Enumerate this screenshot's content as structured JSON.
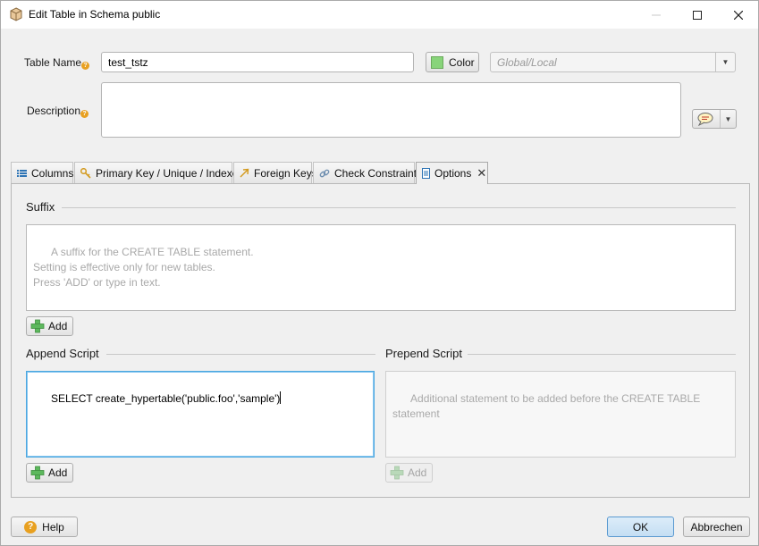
{
  "window": {
    "title": "Edit Table in Schema public"
  },
  "form": {
    "table_name_label": "Table Name",
    "table_name_value": "test_tstz",
    "color_button": "Color",
    "color_swatch": "#88d47a",
    "scope_select": "Global/Local",
    "description_label": "Description",
    "description_value": ""
  },
  "tabs": [
    {
      "label": "Columns",
      "icon": "list-icon",
      "active": false
    },
    {
      "label": "Primary Key / Unique / Indexes",
      "icon": "key-icon",
      "active": false
    },
    {
      "label": "Foreign Keys",
      "icon": "arrow-icon",
      "active": false
    },
    {
      "label": "Check Constraints",
      "icon": "link-icon",
      "active": false
    },
    {
      "label": "Options",
      "icon": "document-icon",
      "active": true
    }
  ],
  "options": {
    "suffix_title": "Suffix",
    "suffix_placeholder": "A suffix for the CREATE TABLE statement.\nSetting is effective only for new tables.\nPress 'ADD' or type in text.",
    "suffix_add": "Add",
    "append_title": "Append Script",
    "append_value": "SELECT create_hypertable('public.foo','sample')",
    "append_add": "Add",
    "prepend_title": "Prepend Script",
    "prepend_placeholder": "Additional statement to be added before the CREATE TABLE statement",
    "prepend_add": "Add"
  },
  "footer": {
    "help": "Help",
    "ok": "OK",
    "cancel": "Abbrechen"
  },
  "colors": {
    "accent_ok": "#cce4f7",
    "focus_border": "#4aa7e0",
    "help_icon": "#e8a020",
    "add_icon": "#5cb85c"
  }
}
